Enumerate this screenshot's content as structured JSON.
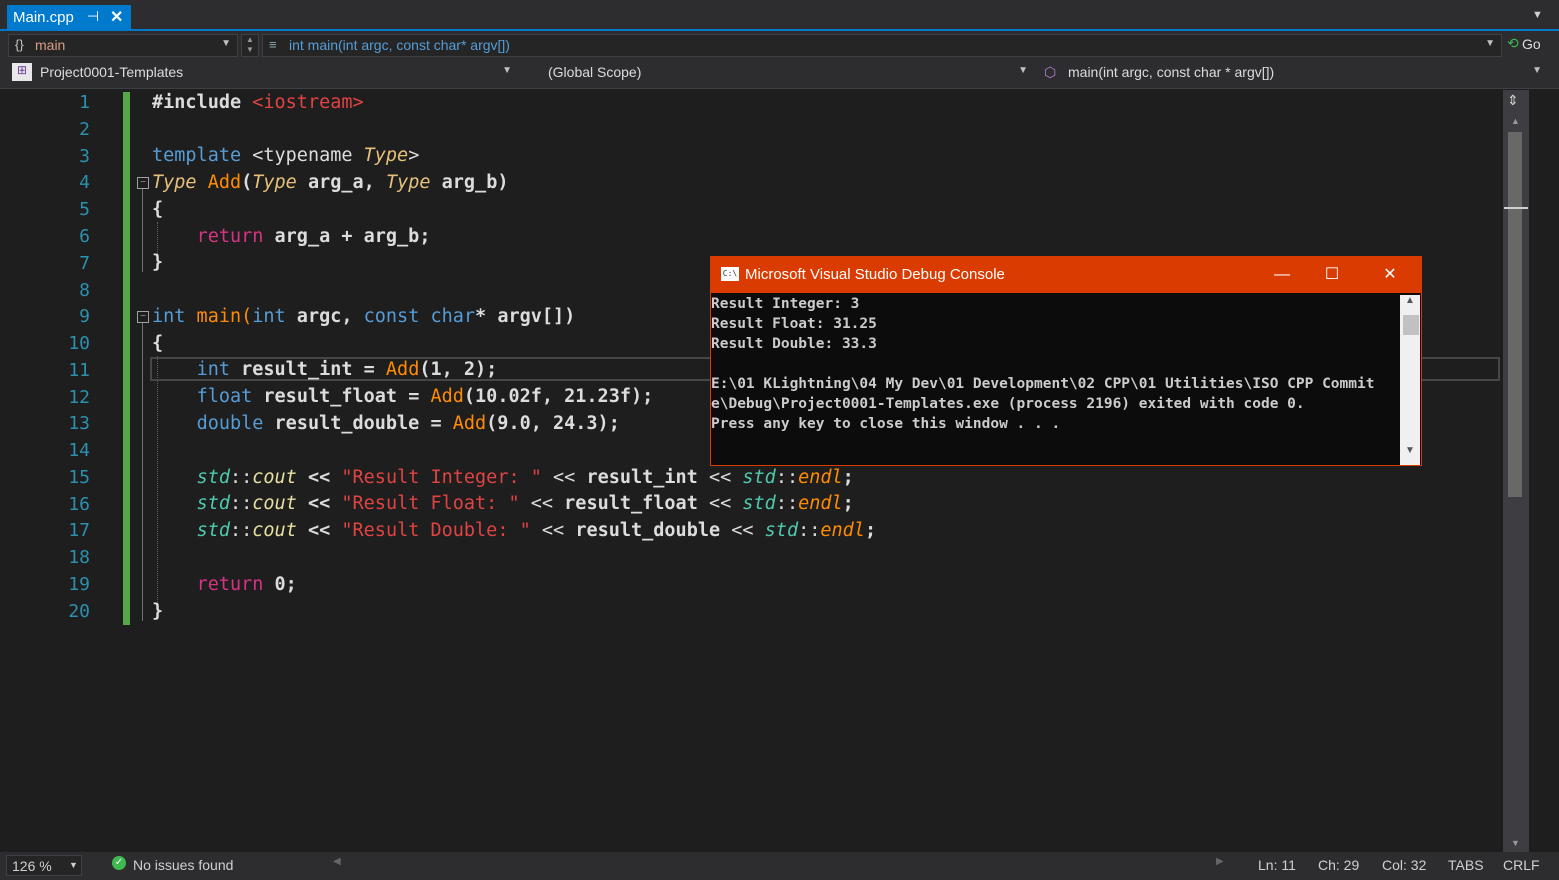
{
  "tab": {
    "label": "Main.cpp",
    "pin": "⊣",
    "close": "✕"
  },
  "nav1": {
    "left_combo": "main",
    "center_combo": "int main(int argc, const char* argv[])",
    "go": "Go"
  },
  "nav2": {
    "project": "Project0001-Templates",
    "scope": "(Global Scope)",
    "member": "main(int argc, const char * argv[])"
  },
  "line_numbers": [
    "1",
    "2",
    "3",
    "4",
    "5",
    "6",
    "7",
    "8",
    "9",
    "10",
    "11",
    "12",
    "13",
    "14",
    "15",
    "16",
    "17",
    "18",
    "19",
    "20"
  ],
  "code": {
    "l1_directive": "#include",
    "l1_header": "<iostream>",
    "l3_template": "template",
    "l3_typename": "<typename",
    "l3_type": "Type",
    "l3_close": ">",
    "l4_type1": "Type",
    "l4_add": "Add",
    "l4_paren": "(",
    "l4_type2": "Type",
    "l4_arg_a": " arg_a, ",
    "l4_type3": "Type",
    "l4_arg_b": " arg_b)",
    "l5": "{",
    "l6_return": "return",
    "l6_expr": " arg_a + arg_b;",
    "l7": "}",
    "l9_int": "int",
    "l9_main": " main(",
    "l9_int2": "int",
    "l9_argc": " argc, ",
    "l9_const": "const",
    "l9_char": " char",
    "l9_rest": "* argv[])",
    "l10": "{",
    "l11_type": "int",
    "l11_var": " result_int = ",
    "l11_add": "Add",
    "l11_args": "(1, 2);",
    "l12_type": "float",
    "l12_var": " result_float = ",
    "l12_add": "Add",
    "l12_args": "(10.02f, 21.23f);",
    "l13_type": "double",
    "l13_var": " result_double = ",
    "l13_add": "Add",
    "l13_args": "(9.0, 24.3);",
    "std": "std",
    "sep": "::",
    "cout": "cout",
    "shl": " << ",
    "endl": "endl",
    "semi": ";",
    "l15_str": "\"Result Integer: \"",
    "l15_var": "result_int",
    "l16_str": "\"Result Float: \"",
    "l16_var": "result_float",
    "l17_str": "\"Result Double: \"",
    "l17_var": "result_double",
    "l19_return": "return",
    "l19_val": " 0;",
    "l20": "}"
  },
  "status": {
    "zoom": "126 %",
    "issues": "No issues found",
    "ln": "Ln: 11",
    "ch": "Ch: 29",
    "col": "Col: 32",
    "tabs": "TABS",
    "eol": "CRLF"
  },
  "console": {
    "title": "Microsoft Visual Studio Debug Console",
    "icon": "C:\\",
    "lines": [
      "Result Integer: 3",
      "Result Float: 31.25",
      "Result Double: 33.3",
      "",
      "E:\\01 KLightning\\04 My Dev\\01 Development\\02 CPP\\01 Utilities\\ISO CPP Commit",
      "e\\Debug\\Project0001-Templates.exe (process 2196) exited with code 0.",
      "Press any key to close this window . . ."
    ],
    "minimize": "—",
    "maximize": "☐",
    "close": "✕"
  },
  "colors": {
    "accent": "#007acc",
    "console_title": "#da3b01",
    "changebar": "#57a64a"
  }
}
